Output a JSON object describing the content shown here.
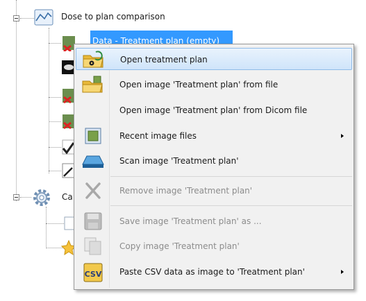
{
  "tree": {
    "nodes": [
      {
        "label": "Dose to plan comparison"
      },
      {
        "label": "Data - Treatment plan (empty)"
      },
      {
        "label": "Ca"
      }
    ]
  },
  "menu": {
    "items": [
      {
        "label": "Open treatment plan",
        "icon": "open-folder-radiation-icon",
        "enabled": true,
        "hover": true
      },
      {
        "label": "Open image 'Treatment plan' from file",
        "icon": "folder-open-icon",
        "enabled": true
      },
      {
        "label": "Open image 'Treatment plan' from Dicom file",
        "icon": "",
        "enabled": true
      },
      {
        "label": "Recent image files",
        "icon": "recent-files-icon",
        "enabled": true,
        "submenu": true
      },
      {
        "label": "Scan image 'Treatment plan'",
        "icon": "scanner-icon",
        "enabled": true
      },
      {
        "label": "Remove image 'Treatment plan'",
        "icon": "remove-x-icon",
        "enabled": false
      },
      {
        "label": "Save image 'Treatment plan' as ...",
        "icon": "floppy-disk-icon",
        "enabled": false
      },
      {
        "label": "Copy image 'Treatment plan'",
        "icon": "copy-icon",
        "enabled": false
      },
      {
        "label": "Paste CSV data as image to 'Treatment plan'",
        "icon": "csv-icon",
        "enabled": true,
        "submenu": true
      }
    ]
  },
  "colors": {
    "selection": "#3399ff",
    "menu_background": "#f1f1f1",
    "menu_hover": "#cfe4fa",
    "disabled_text": "#8c8c8c"
  }
}
